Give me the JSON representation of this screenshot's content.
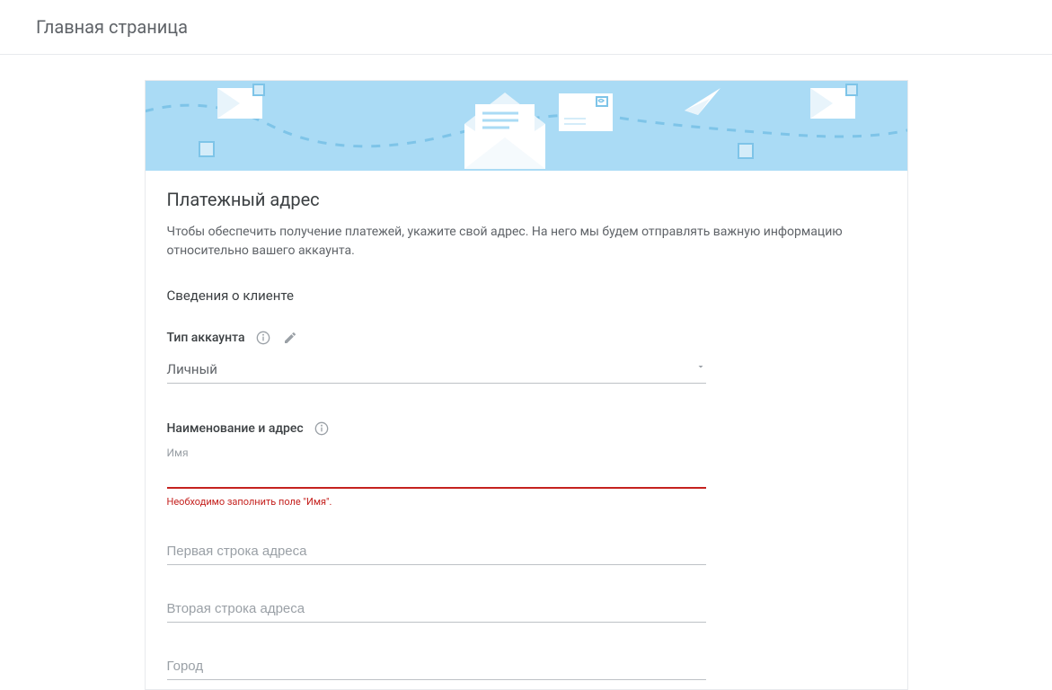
{
  "header": {
    "title": "Главная страница"
  },
  "card": {
    "title": "Платежный адрес",
    "description": "Чтобы обеспечить получение платежей, укажите свой адрес. На него мы будем отправлять важную информацию относительно вашего аккаунта.",
    "clientInfoHeading": "Сведения о клиенте",
    "accountType": {
      "label": "Тип аккаунта",
      "value": "Личный"
    },
    "nameAddressLabel": "Наименование и адрес",
    "fields": {
      "name": {
        "label": "Имя",
        "value": "",
        "error": "Необходимо заполнить поле \"Имя\"."
      },
      "address1": {
        "placeholder": "Первая строка адреса",
        "value": ""
      },
      "address2": {
        "placeholder": "Вторая строка адреса",
        "value": ""
      },
      "city": {
        "placeholder": "Город",
        "value": ""
      }
    }
  }
}
